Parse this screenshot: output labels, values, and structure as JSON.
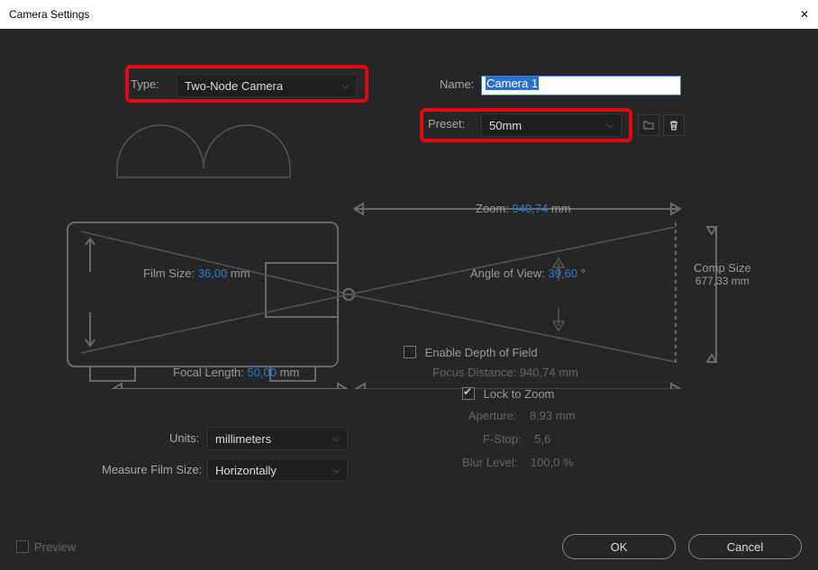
{
  "window": {
    "title": "Camera Settings"
  },
  "row1": {
    "type_label": "Type:",
    "type_value": "Two-Node Camera",
    "name_label": "Name:",
    "name_value": "Camera 1",
    "preset_label": "Preset:",
    "preset_value": "50mm"
  },
  "diagram": {
    "zoom_label": "Zoom:",
    "zoom_value": "940,74",
    "zoom_unit": "mm",
    "film_size_label": "Film Size:",
    "film_size_value": "36,00",
    "film_size_unit": "mm",
    "angle_label": "Angle of View:",
    "angle_value": "39,60",
    "angle_unit": "°",
    "comp_size_label": "Comp Size",
    "comp_size_value": "677,33 mm",
    "focal_label": "Focal Length:",
    "focal_value": "50,00",
    "focal_unit": "mm",
    "enable_dof_label": "Enable Depth of Field",
    "enable_dof_checked": false,
    "focus_dist_label": "Focus Distance:",
    "focus_dist_value": "940,74 mm",
    "lock_zoom_label": "Lock to Zoom",
    "lock_zoom_checked": true,
    "aperture_label": "Aperture:",
    "aperture_value": "8,93 mm",
    "fstop_label": "F-Stop:",
    "fstop_value": "5,6",
    "blur_label": "Blur Level:",
    "blur_value": "100,0 %"
  },
  "options": {
    "units_label": "Units:",
    "units_value": "millimeters",
    "measure_label": "Measure Film Size:",
    "measure_value": "Horizontally"
  },
  "footer": {
    "preview_label": "Preview",
    "ok_label": "OK",
    "cancel_label": "Cancel"
  }
}
